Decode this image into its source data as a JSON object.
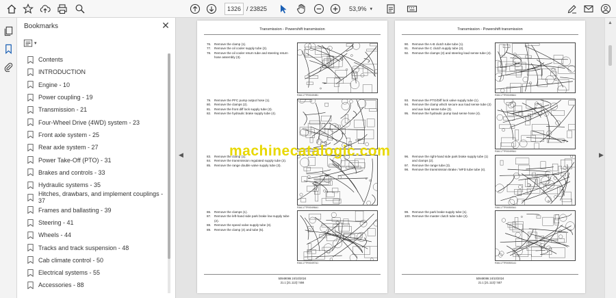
{
  "toolbar": {
    "page_current": "1326",
    "page_total": "/ 23825",
    "zoom": "53,9%"
  },
  "bookmarks": {
    "title": "Bookmarks",
    "items": [
      {
        "label": "Contents"
      },
      {
        "label": "INTRODUCTION"
      },
      {
        "label": "Engine - 10"
      },
      {
        "label": "Power coupling - 19"
      },
      {
        "label": "Transmission - 21"
      },
      {
        "label": "Four-Wheel Drive (4WD) system - 23"
      },
      {
        "label": "Front axle system - 25"
      },
      {
        "label": "Rear axle system - 27"
      },
      {
        "label": "Power Take-Off (PTO) - 31"
      },
      {
        "label": "Brakes and controls - 33"
      },
      {
        "label": "Hydraulic systems - 35"
      },
      {
        "label": "Hitches, drawbars, and implement couplings - 37"
      },
      {
        "label": "Frames and ballasting - 39"
      },
      {
        "label": "Steering - 41"
      },
      {
        "label": "Wheels - 44"
      },
      {
        "label": "Tracks and track suspension - 48"
      },
      {
        "label": "Cab climate control - 50"
      },
      {
        "label": "Electrical systems - 55"
      },
      {
        "label": "Accessories - 88"
      }
    ]
  },
  "pages": {
    "left": {
      "header": "Transmission - Powershift transmission",
      "groups": [
        {
          "steps": [
            {
              "n": "76.",
              "t": "Remove the clamp (1)."
            },
            {
              "n": "77.",
              "t": "Remove the oil cooler supply tube (2)."
            },
            {
              "n": "78.",
              "t": "Remove the oil cooler return tube and steering return hose assembly (3)."
            }
          ],
          "ref": "RAIL17TR00494B1"
        },
        {
          "steps": [
            {
              "n": "79.",
              "t": "Remove the PFC pump output hose (1)."
            },
            {
              "n": "80.",
              "t": "Remove the clamps (2)."
            },
            {
              "n": "81.",
              "t": "Remove the front diff lock supply tube (3)."
            },
            {
              "n": "82.",
              "t": "Remove the hydraulic brake supply tube (4)."
            }
          ],
          "ref": "RAIL17TR00495A1"
        },
        {
          "steps": [
            {
              "n": "83.",
              "t": "Remove the clamp (1)."
            },
            {
              "n": "84.",
              "t": "Remove the transmission regulated supply tube (2)."
            },
            {
              "n": "85.",
              "t": "Remove the range double valve supply tube (3)."
            }
          ],
          "ref": "RAIL17TR00496A1"
        },
        {
          "steps": [
            {
              "n": "86.",
              "t": "Remove the clamps (1)."
            },
            {
              "n": "87.",
              "t": "Remove the left-hand side park brake low supply tube (2)."
            },
            {
              "n": "88.",
              "t": "Remove the speed valve supply tube (3)."
            },
            {
              "n": "89.",
              "t": "Remove the clamp (4) and tube (5)."
            }
          ],
          "ref": "RAIL17TR00497A1"
        }
      ],
      "footer_doc": "50949086 24/10/2024",
      "footer_page": "21.1 [21.113] / 556"
    },
    "right": {
      "header": "Transmission - Powershift transmission",
      "groups": [
        {
          "steps": [
            {
              "n": "90.",
              "t": "Remove the A-B clutch tube tube (1)."
            },
            {
              "n": "91.",
              "t": "Remove the C clutch supply tube (2)."
            },
            {
              "n": "92.",
              "t": "Remove the clamps (3) and steering load sense tube (4)."
            }
          ],
          "ref": "RAIL17TR00498A1"
        },
        {
          "steps": [
            {
              "n": "93.",
              "t": "Remove the PTO/Diff lock valve supply tube (1)."
            },
            {
              "n": "94.",
              "t": "Remove the clamp which secure aux load sense tube (2) and aux load sense tube (3)."
            },
            {
              "n": "95.",
              "t": "Remove the hydraulic pump load sense hose (4)."
            }
          ],
          "ref": "RAIL17TR00499A1"
        },
        {
          "steps": [
            {
              "n": "96.",
              "t": "Remove the right-hand side park brake supply tube (1) and clamps (2)."
            },
            {
              "n": "97.",
              "t": "Remove the range tube (3)."
            },
            {
              "n": "98.",
              "t": "Remove the transmission Brake / MFD tube tube (4)."
            }
          ],
          "ref": "RAIL17TR00500A1"
        },
        {
          "steps": [
            {
              "n": "99.",
              "t": "Remove the park brake supply tube (1)."
            },
            {
              "n": "100.",
              "t": "Remove the master clutch tube tube (2)."
            }
          ],
          "ref": "RAIL17TR00501A1"
        }
      ],
      "footer_doc": "50949086 24/10/2024",
      "footer_page": "21.1 [21.113] / 557"
    }
  },
  "watermark": "machinecatalogic.com"
}
